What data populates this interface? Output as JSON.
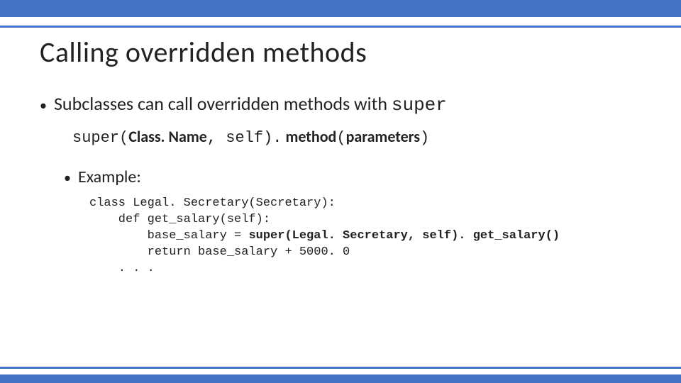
{
  "title": "Calling overridden methods",
  "bullet1_prefix": "Subclasses can call overridden methods with ",
  "bullet1_code": "super",
  "syntax": {
    "p1": "super(",
    "classname": "Class. Name",
    "p2": ", self).",
    "method": " method",
    "p3": "(",
    "params": "parameters",
    "p4": ")"
  },
  "bullet2": "Example:",
  "code": {
    "l1": "class Legal. Secretary(Secretary):",
    "l2": "    def get_salary(self):",
    "l3a": "        base_salary = ",
    "l3b": "super(Legal. Secretary, self). get_salary()",
    "l4": "        return base_salary + 5000. 0",
    "l5": "    . . ."
  }
}
